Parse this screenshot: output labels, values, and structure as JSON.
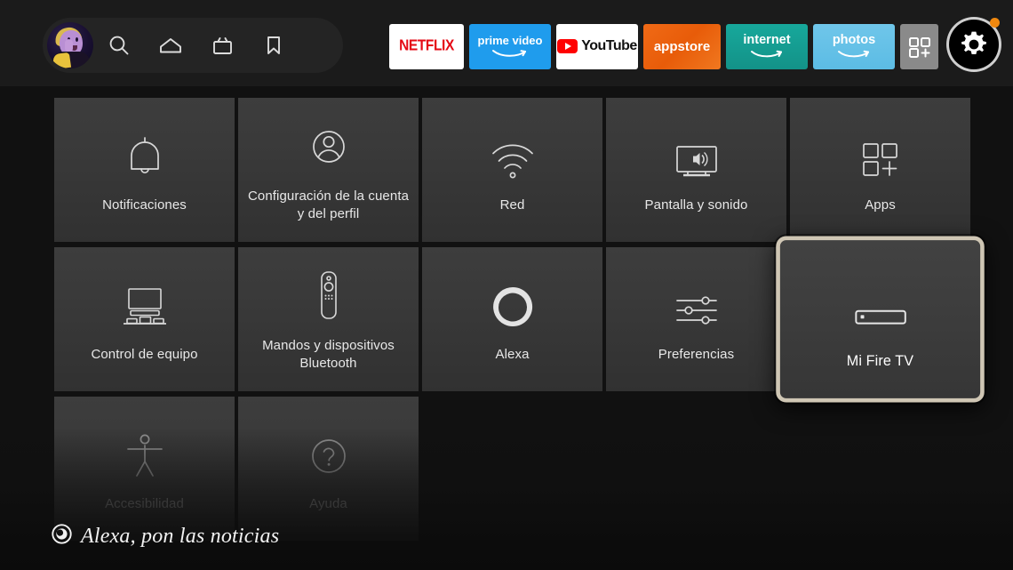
{
  "topbar": {
    "avatar": {
      "name": "profile-avatar",
      "alt": "Perfil"
    },
    "nav_icons": [
      {
        "name": "search-icon",
        "label": "Buscar"
      },
      {
        "name": "home-icon",
        "label": "Inicio"
      },
      {
        "name": "live-tv-icon",
        "label": "TV en directo"
      },
      {
        "name": "bookmark-icon",
        "label": "Guardados"
      }
    ],
    "apps": [
      {
        "name": "netflix",
        "label": "NETFLIX",
        "color": "#e50914",
        "bg": "#ffffff"
      },
      {
        "name": "prime-video",
        "label": "prime video",
        "color": "#ffffff",
        "bg": "#1f9ced"
      },
      {
        "name": "youtube",
        "label": "YouTube",
        "color": "#111111",
        "bg": "#ffffff"
      },
      {
        "name": "appstore",
        "label": "appstore",
        "color": "#ffffff",
        "bg": "#ec6209"
      },
      {
        "name": "internet",
        "label": "internet",
        "color": "#ffffff",
        "bg": "#15a195"
      },
      {
        "name": "photos",
        "label": "photos",
        "color": "#ffffff",
        "bg": "#63c0e7"
      }
    ],
    "more_apps": {
      "name": "add-apps-icon",
      "label": "Más aplicaciones"
    },
    "settings": {
      "name": "settings-gear",
      "label": "Ajustes",
      "selected": true,
      "badge": true,
      "badge_color": "#f0880f"
    }
  },
  "settings_grid": {
    "tiles": [
      {
        "label": "Notificaciones",
        "icon": "bell-icon",
        "dimmed": false,
        "selected": false
      },
      {
        "label": "Configuración de la cuenta y del perfil",
        "icon": "account-profile-icon",
        "dimmed": false,
        "selected": false
      },
      {
        "label": "Red",
        "icon": "wifi-icon",
        "dimmed": false,
        "selected": false
      },
      {
        "label": "Pantalla y sonido",
        "icon": "display-sound-icon",
        "dimmed": false,
        "selected": false
      },
      {
        "label": "Apps",
        "icon": "apps-grid-icon",
        "dimmed": false,
        "selected": false
      },
      {
        "label": "Control de equipo",
        "icon": "equipment-control-icon",
        "dimmed": false,
        "selected": false
      },
      {
        "label": "Mandos y dispositivos Bluetooth",
        "icon": "remote-bluetooth-icon",
        "dimmed": false,
        "selected": false
      },
      {
        "label": "Alexa",
        "icon": "alexa-ring-icon",
        "dimmed": false,
        "selected": false
      },
      {
        "label": "Preferencias",
        "icon": "sliders-icon",
        "dimmed": false,
        "selected": false
      },
      {
        "label": "Mi Fire TV",
        "icon": "fire-tv-stick-icon",
        "dimmed": false,
        "selected": true
      },
      {
        "label": "Accesibilidad",
        "icon": "accessibility-icon",
        "dimmed": true,
        "selected": false
      },
      {
        "label": "Ayuda",
        "icon": "help-question-icon",
        "dimmed": true,
        "selected": false
      }
    ]
  },
  "alexa_hint": {
    "icon": "alexa-mic-icon",
    "text": "Alexa, pon las noticias"
  }
}
